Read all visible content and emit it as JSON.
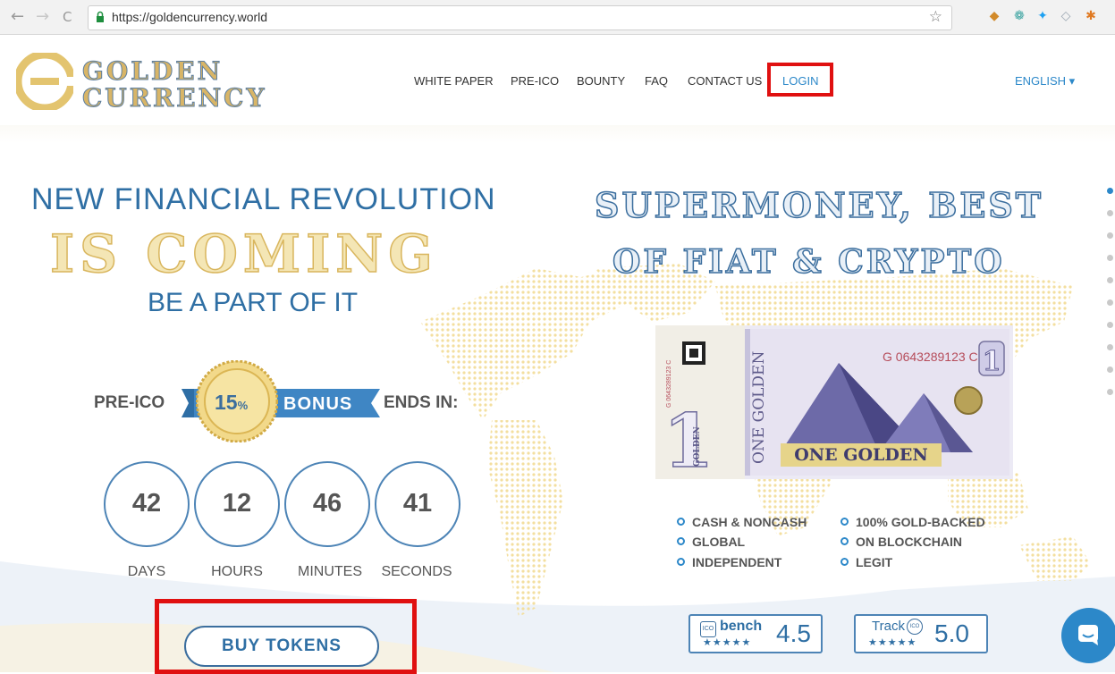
{
  "browser": {
    "url": "https://goldencurrency.world",
    "back_icon": "←",
    "forward_icon": "→",
    "reload_icon": "C",
    "star_icon": "☆"
  },
  "header": {
    "logo_line1": "GOLDEN",
    "logo_line2": "CURRENCY",
    "nav": [
      "WHITE PAPER",
      "PRE-ICO",
      "BOUNTY",
      "FAQ",
      "CONTACT US"
    ],
    "login": "LOGIN",
    "language": "ENGLISH ▾"
  },
  "hero": {
    "line1": "NEW FINANCIAL REVOLUTION",
    "line2": "IS COMING",
    "line3": "BE A PART OF IT",
    "right_line1": "SUPERMONEY, BEST",
    "right_line2": "OF FIAT & CRYPTO"
  },
  "promo": {
    "prefix": "PRE-ICO",
    "percent": "15",
    "percent_sign": "%",
    "bonus": "BONUS",
    "suffix": "ENDS IN:"
  },
  "countdown": [
    {
      "value": "42",
      "label": "DAYS"
    },
    {
      "value": "12",
      "label": "HOURS"
    },
    {
      "value": "46",
      "label": "MINUTES"
    },
    {
      "value": "41",
      "label": "SECONDS"
    }
  ],
  "cta": {
    "label": "BUY TOKENS"
  },
  "banknote": {
    "serial": "G 0643289123 C",
    "denomination": "1",
    "side_text": "ONE GOLDEN",
    "name": "ONE GOLDEN",
    "small_serial": "G 0643289123 C",
    "small_word": "GOLDEN"
  },
  "features": {
    "left": [
      "CASH & NONCASH",
      "GLOBAL",
      "INDEPENDENT"
    ],
    "right": [
      "100% GOLD-BACKED",
      "ON BLOCKCHAIN",
      "LEGIT"
    ]
  },
  "ratings": [
    {
      "brand_small": "ICO",
      "brand": "bench",
      "stars": "★★★★★",
      "score": "4.5"
    },
    {
      "brand_small": "ICO",
      "brand": "Track",
      "stars": "★★★★★",
      "score": "5.0"
    }
  ],
  "colors": {
    "accent_blue": "#2f6fa4",
    "gold": "#d9b65e",
    "highlight_red": "#e01010"
  }
}
